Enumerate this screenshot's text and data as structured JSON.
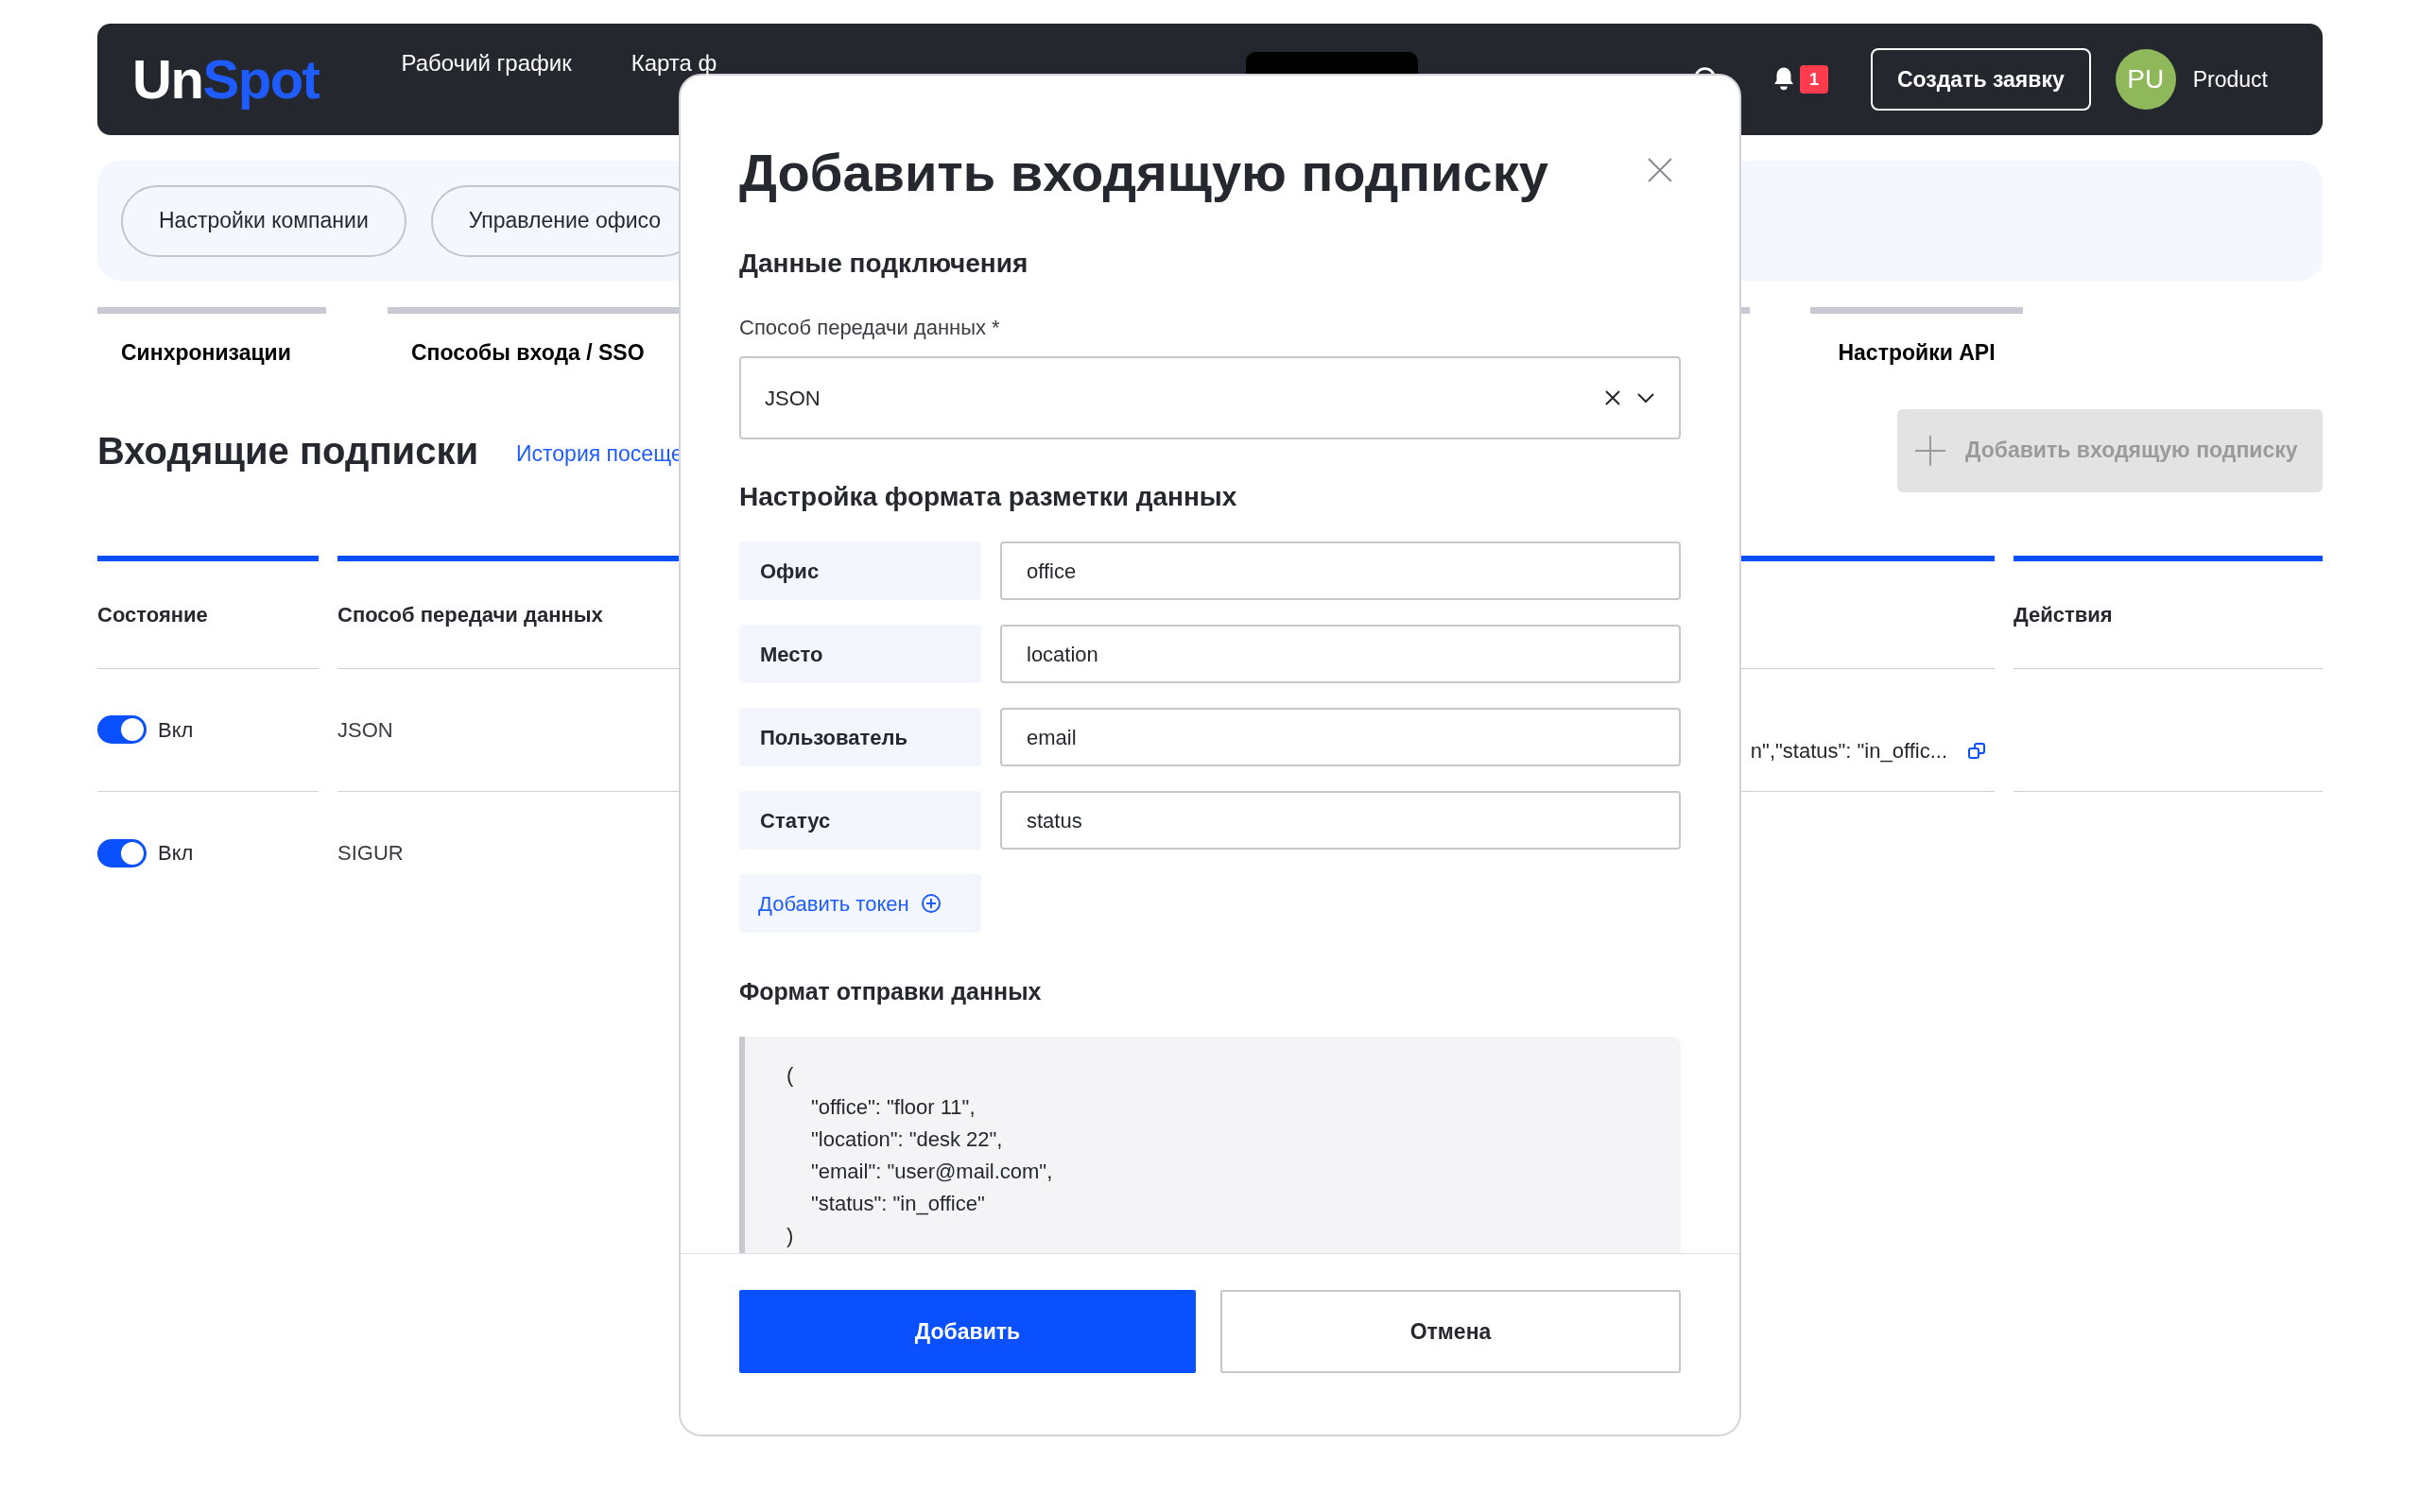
{
  "top_nav": {
    "logo": {
      "part_1": "Un",
      "part_2": "Spot"
    },
    "items": [
      {
        "label": "Рабочий график"
      },
      {
        "label": "Карта ф"
      }
    ],
    "notification_count": "1",
    "create_button": "Создать заявку",
    "user": {
      "initials": "PU",
      "name": "Product"
    }
  },
  "settings_tabs": [
    {
      "label": "Настройки компании"
    },
    {
      "label": "Управление офисо"
    }
  ],
  "section_tabs": [
    {
      "label": "Синхронизации"
    },
    {
      "label": "Способы входа / SSO"
    },
    {
      "label": "Настройки API"
    }
  ],
  "page_section": {
    "title": "Входящие подписки",
    "history_link": "История посеще",
    "add_button": {
      "label": "Добавить входящую подписку",
      "disabled": true
    }
  },
  "table": {
    "columns": {
      "state": "Состояние",
      "method": "Способ передачи данных",
      "actions": "Действия"
    },
    "rows": [
      {
        "enabled": true,
        "state_label": "Вкл",
        "method": "JSON",
        "column_3": "n\",\"status\": \"in_offic..."
      },
      {
        "enabled": true,
        "state_label": "Вкл",
        "method": "SIGUR"
      }
    ]
  },
  "modal": {
    "title": "Добавить входящую подписку",
    "connection_heading": "Данные подключения",
    "method_field": {
      "label": "Способ передачи данных *",
      "value": "JSON"
    },
    "mapping_heading": "Настройка формата разметки данных",
    "mappings": [
      {
        "label": "Офис",
        "value": "office"
      },
      {
        "label": "Место",
        "value": "location"
      },
      {
        "label": "Пользователь",
        "value": "email"
      },
      {
        "label": "Статус",
        "value": "status"
      }
    ],
    "add_token": "Добавить токен",
    "format_heading": "Формат отправки данных",
    "format_code": {
      "open": "(",
      "lines": [
        "\"office\": \"floor 11\",",
        "\"location\": \"desk 22\",",
        "\"email\": \"user@mail.com\",",
        "\"status\": \"in_office\""
      ],
      "close": ")"
    },
    "submit": "Добавить",
    "cancel": "Отмена"
  }
}
